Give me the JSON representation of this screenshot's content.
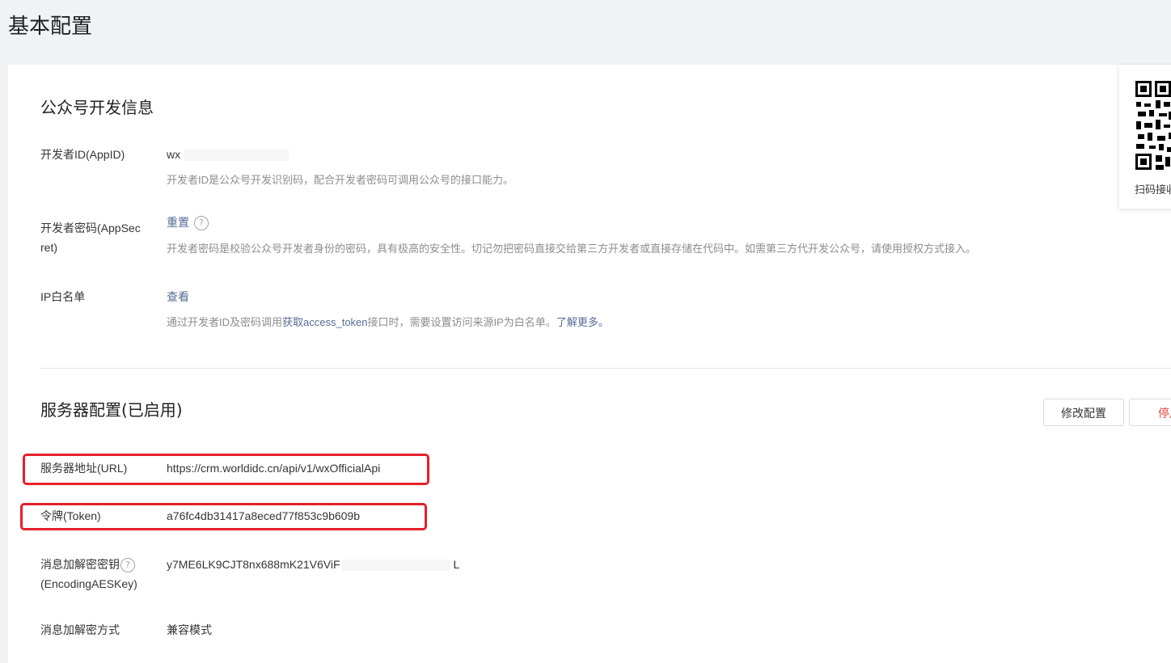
{
  "page": {
    "title": "基本配置"
  },
  "dev_info": {
    "title": "公众号开发信息",
    "appid": {
      "label": "开发者ID(AppID)",
      "value": "wx",
      "desc": "开发者ID是公众号开发识别码，配合开发者密码可调用公众号的接口能力。"
    },
    "appsecret": {
      "label_line1": "开发者密码(AppSec",
      "label_line2": "ret)",
      "action": "重置",
      "help": "?",
      "desc": "开发者密码是校验公众号开发者身份的密码，具有极高的安全性。切记勿把密码直接交给第三方开发者或直接存储在代码中。如需第三方代开发公众号，请使用授权方式接入。"
    },
    "ip_whitelist": {
      "label": "IP白名单",
      "action": "查看",
      "desc_before": "通过开发者ID及密码调用",
      "desc_link1": "获取access_token",
      "desc_middle": "接口时，需要设置访问来源IP为白名单。",
      "desc_link2": "了解更多。"
    }
  },
  "server_config": {
    "title": "服务器配置(已启用)",
    "modify_button": "修改配置",
    "stop_button": "停用",
    "url": {
      "label": "服务器地址(URL)",
      "value": "https://crm.worldidc.cn/api/v1/wxOfficialApi"
    },
    "token": {
      "label": "令牌(Token)",
      "value": "a76fc4db31417a8eced77f853c9b609b"
    },
    "aes_key": {
      "label_line1": "消息加解密密钥",
      "label_line2": "(EncodingAESKey)",
      "help": "?",
      "value_visible": "y7ME6LK9CJT8nx688mK21V6ViF",
      "value_tail": "L"
    },
    "encrypt_mode": {
      "label": "消息加解密方式",
      "value": "兼容模式"
    }
  },
  "qr": {
    "caption": "扫码接收"
  },
  "colors": {
    "link": "#576b95",
    "danger": "#e64340",
    "highlight": "#e5202b"
  }
}
